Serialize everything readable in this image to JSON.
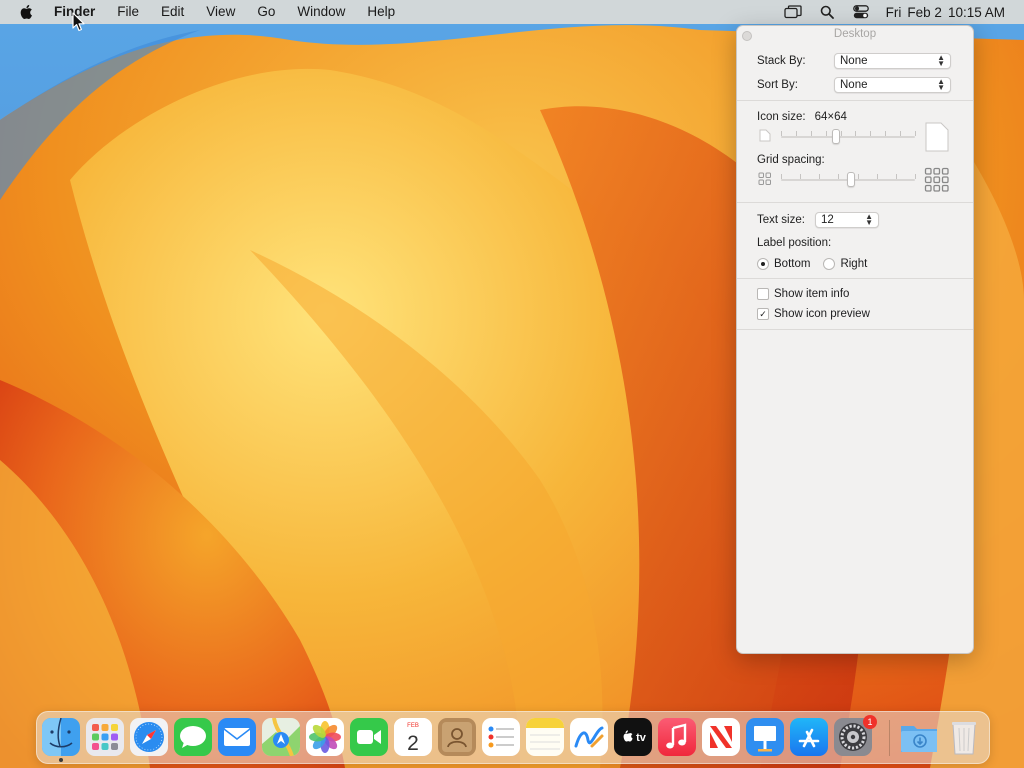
{
  "menubar": {
    "app_name": "Finder",
    "menus": [
      "File",
      "Edit",
      "View",
      "Go",
      "Window",
      "Help"
    ],
    "status_icons": [
      "screen-mirroring-icon",
      "spotlight-search-icon",
      "control-center-icon"
    ],
    "clock": {
      "day": "Fri",
      "date": "Feb 2",
      "time": "10:15 AM"
    }
  },
  "panel": {
    "title": "Desktop",
    "stack_by": {
      "label": "Stack By:",
      "value": "None"
    },
    "sort_by": {
      "label": "Sort By:",
      "value": "None"
    },
    "icon_size": {
      "label": "Icon size:",
      "value": "64×64",
      "level": 0.41
    },
    "grid_spacing": {
      "label": "Grid spacing:",
      "level": 0.52
    },
    "text_size": {
      "label": "Text size:",
      "value": "12"
    },
    "label_position": {
      "label": "Label position:",
      "options": [
        {
          "label": "Bottom",
          "selected": true
        },
        {
          "label": "Right",
          "selected": false
        }
      ]
    },
    "checkboxes": [
      {
        "label": "Show item info",
        "checked": false
      },
      {
        "label": "Show icon preview",
        "checked": true
      }
    ]
  },
  "dock": {
    "apps": [
      {
        "name": "Finder",
        "icon": "finder-icon",
        "running": true
      },
      {
        "name": "Launchpad",
        "icon": "launchpad-icon"
      },
      {
        "name": "Safari",
        "icon": "safari-icon"
      },
      {
        "name": "Messages",
        "icon": "messages-icon"
      },
      {
        "name": "Mail",
        "icon": "mail-icon"
      },
      {
        "name": "Maps",
        "icon": "maps-icon"
      },
      {
        "name": "Photos",
        "icon": "photos-icon"
      },
      {
        "name": "FaceTime",
        "icon": "facetime-icon"
      },
      {
        "name": "Calendar",
        "icon": "calendar-icon",
        "month": "FEB",
        "day": "2"
      },
      {
        "name": "Contacts",
        "icon": "contacts-icon"
      },
      {
        "name": "Reminders",
        "icon": "reminders-icon"
      },
      {
        "name": "Notes",
        "icon": "notes-icon"
      },
      {
        "name": "Freeform",
        "icon": "freeform-icon"
      },
      {
        "name": "TV",
        "icon": "tv-icon",
        "text": "tv"
      },
      {
        "name": "Music",
        "icon": "music-icon"
      },
      {
        "name": "News",
        "icon": "news-icon"
      },
      {
        "name": "Keynote",
        "icon": "keynote-icon"
      },
      {
        "name": "App Store",
        "icon": "app-store-icon"
      },
      {
        "name": "System Settings",
        "icon": "system-settings-icon",
        "badge": "1"
      }
    ],
    "extras": [
      {
        "name": "Downloads",
        "icon": "downloads-folder-icon"
      },
      {
        "name": "Trash",
        "icon": "trash-icon"
      }
    ]
  },
  "colors": {
    "wallpaper_base": "#f29a1f",
    "wallpaper_sky": "#4a9ee0",
    "accent_red": "#e3431c",
    "badge_red": "#f0322a"
  }
}
